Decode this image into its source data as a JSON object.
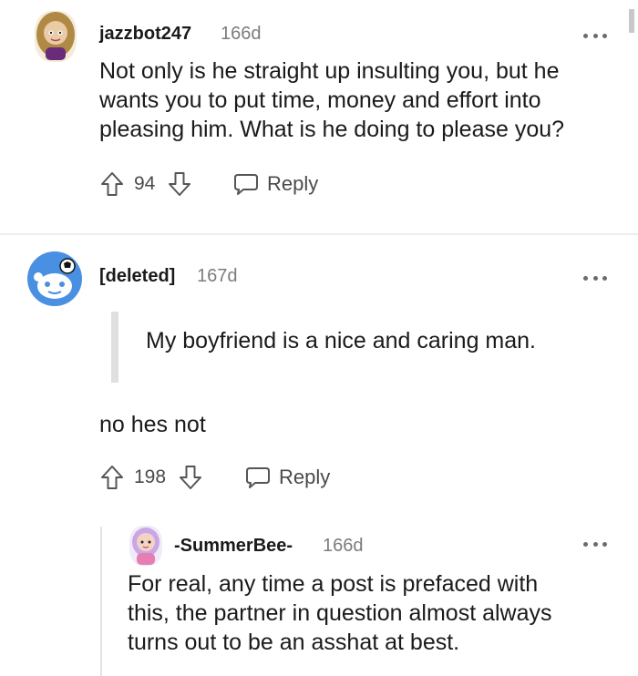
{
  "comments": [
    {
      "username": "jazzbot247",
      "age": "166d",
      "lines": [
        "Not only is he straight up insulting you, but he",
        "wants you to put time, money and effort into",
        "pleasing him. What is he doing to please you?"
      ],
      "votes": "94",
      "reply_label": "Reply"
    },
    {
      "username": "[deleted]",
      "age": "167d",
      "quote": "My boyfriend is a nice and caring man.",
      "text": "no hes not",
      "votes": "198",
      "reply_label": "Reply"
    },
    {
      "username": "-SummerBee-",
      "age": "166d",
      "lines": [
        "For real, any time a post is prefaced with",
        "this, the partner in question almost always",
        "turns out to be an asshat at best."
      ]
    }
  ],
  "colors": {
    "text": "#1a1a1b",
    "meta": "#7c7c7c",
    "snoo_bg": "#4a90e2",
    "divider": "#ededed"
  }
}
